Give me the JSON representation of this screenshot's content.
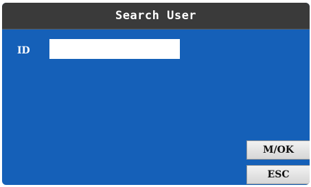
{
  "dialog": {
    "title": "Search User"
  },
  "form": {
    "id_label": "ID",
    "id_value": ""
  },
  "softkeys": {
    "ok_label": "M/OK",
    "esc_label": "ESC"
  },
  "colors": {
    "background": "#1560b8",
    "title_bar": "#3a3a3a",
    "button_face": "#e4e4e4"
  }
}
